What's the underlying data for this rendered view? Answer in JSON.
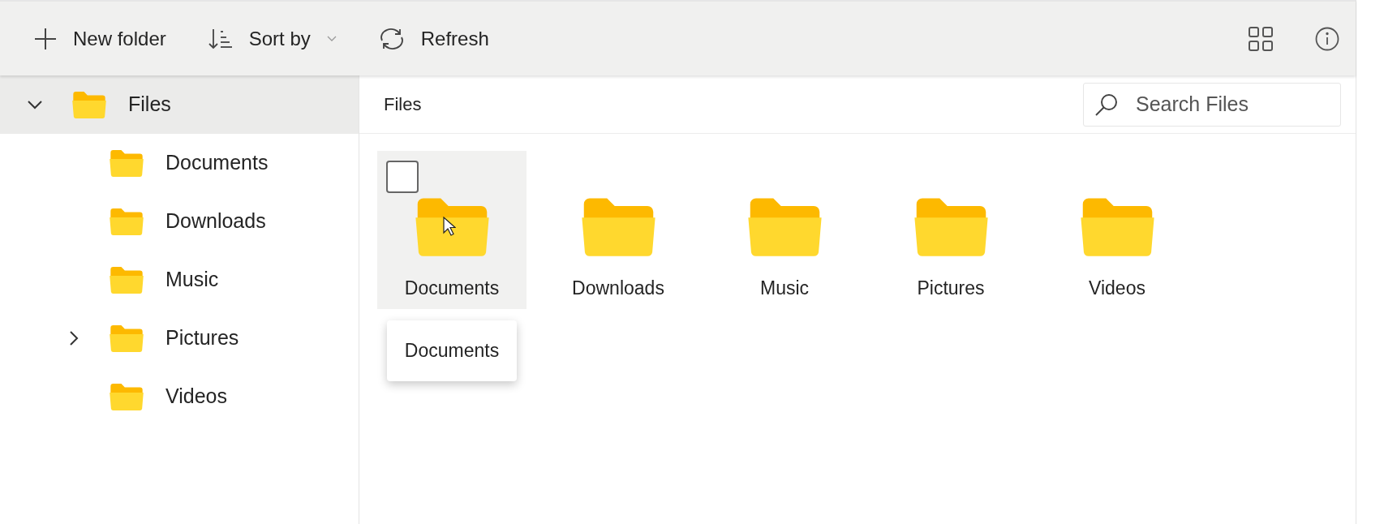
{
  "toolbar": {
    "commands": [
      {
        "kind": "new",
        "label": "New folder"
      },
      {
        "kind": "sort",
        "label": "Sort by"
      },
      {
        "kind": "refresh",
        "label": "Refresh"
      }
    ]
  },
  "tree": {
    "label": "Files",
    "expanded": true,
    "selected": true,
    "children": [
      {
        "label": "Documents",
        "expandable": false
      },
      {
        "label": "Downloads",
        "expandable": false
      },
      {
        "label": "Music",
        "expandable": false
      },
      {
        "label": "Pictures",
        "expandable": true
      },
      {
        "label": "Videos",
        "expandable": false
      }
    ]
  },
  "breadcrumb": "Files",
  "search": {
    "placeholder": "Search Files"
  },
  "tiles": [
    {
      "label": "Documents",
      "hovered": true,
      "checked": false
    },
    {
      "label": "Downloads",
      "hovered": false,
      "checked": false
    },
    {
      "label": "Music",
      "hovered": false,
      "checked": false
    },
    {
      "label": "Pictures",
      "hovered": false,
      "checked": false
    },
    {
      "label": "Videos",
      "hovered": false,
      "checked": false
    }
  ],
  "tooltip": "Documents"
}
